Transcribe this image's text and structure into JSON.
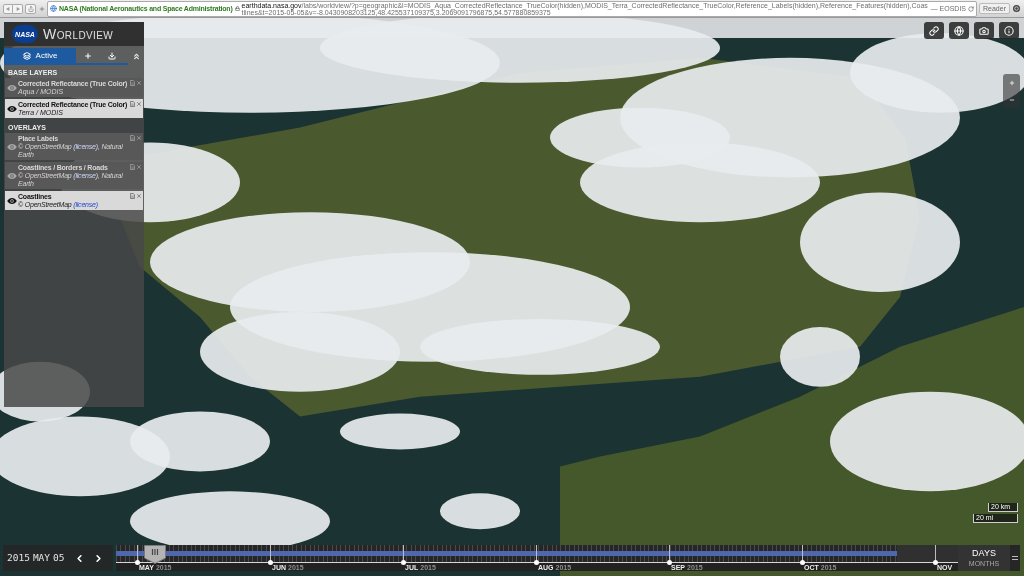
{
  "browser": {
    "site_identity": "NASA (National Aeronautics and Space Administration)",
    "url_host": "earthdata.nasa.gov",
    "url_path": "/labs/worldview/?p=geographic&l=MODIS_Aqua_CorrectedReflectance_TrueColor(hidden),MODIS_Terra_CorrectedReflectance_TrueColor,Reference_Labels(hidden),Reference_Features(hidden),Coastlines&t=2015-05-05&v=-8.0430908203125,48.425537109375,3.2069091796875,54.577880859375",
    "page_title": "— EOSDIS",
    "reader_button": "Reader"
  },
  "app": {
    "logo": "NASA",
    "title": "WORLDVIEW"
  },
  "layers_panel": {
    "tabs": [
      {
        "kind": "active",
        "label": "Active",
        "selected": true
      },
      {
        "kind": "add",
        "selected": false
      },
      {
        "kind": "download",
        "selected": false
      }
    ],
    "groups": [
      {
        "title": "BASE LAYERS",
        "layers": [
          {
            "name": "Corrected Reflectance (True Color)",
            "source": "Aqua / MODIS",
            "visible": false
          },
          {
            "name": "Corrected Reflectance (True Color)",
            "source": "Terra / MODIS",
            "visible": true
          }
        ]
      },
      {
        "title": "OVERLAYS",
        "layers": [
          {
            "name": "Place Labels",
            "attribution": "© OpenStreetMap",
            "link": "(license)",
            "attribution_end": ", Natural Earth",
            "visible": false
          },
          {
            "name": "Coastlines / Borders / Roads",
            "attribution": "© OpenStreetMap",
            "link": "(license)",
            "attribution_end": ", Natural Earth",
            "visible": false
          },
          {
            "name": "Coastlines",
            "attribution": "© OpenStreetMap",
            "link": "(license)",
            "visible": true
          }
        ]
      }
    ]
  },
  "scale_bars": [
    "20 km",
    "20 mi"
  ],
  "timeline": {
    "date": {
      "year": "2015",
      "month": "MAY",
      "day": "05"
    },
    "data_range": {
      "level": 0.928
    },
    "handle": {
      "level": 0.046
    },
    "months": [
      {
        "label": "MAY",
        "year": "2015"
      },
      {
        "label": "JUN",
        "year": "2015"
      },
      {
        "label": "JUL",
        "year": "2015"
      },
      {
        "label": "AUG",
        "year": "2015"
      },
      {
        "label": "SEP",
        "year": "2015"
      },
      {
        "label": "OCT",
        "year": "2015"
      },
      {
        "label": "NOV"
      }
    ],
    "zoom_levels": [
      {
        "label": "DAYS",
        "selected": true
      },
      {
        "label": "MONTHS",
        "selected": false
      }
    ]
  }
}
